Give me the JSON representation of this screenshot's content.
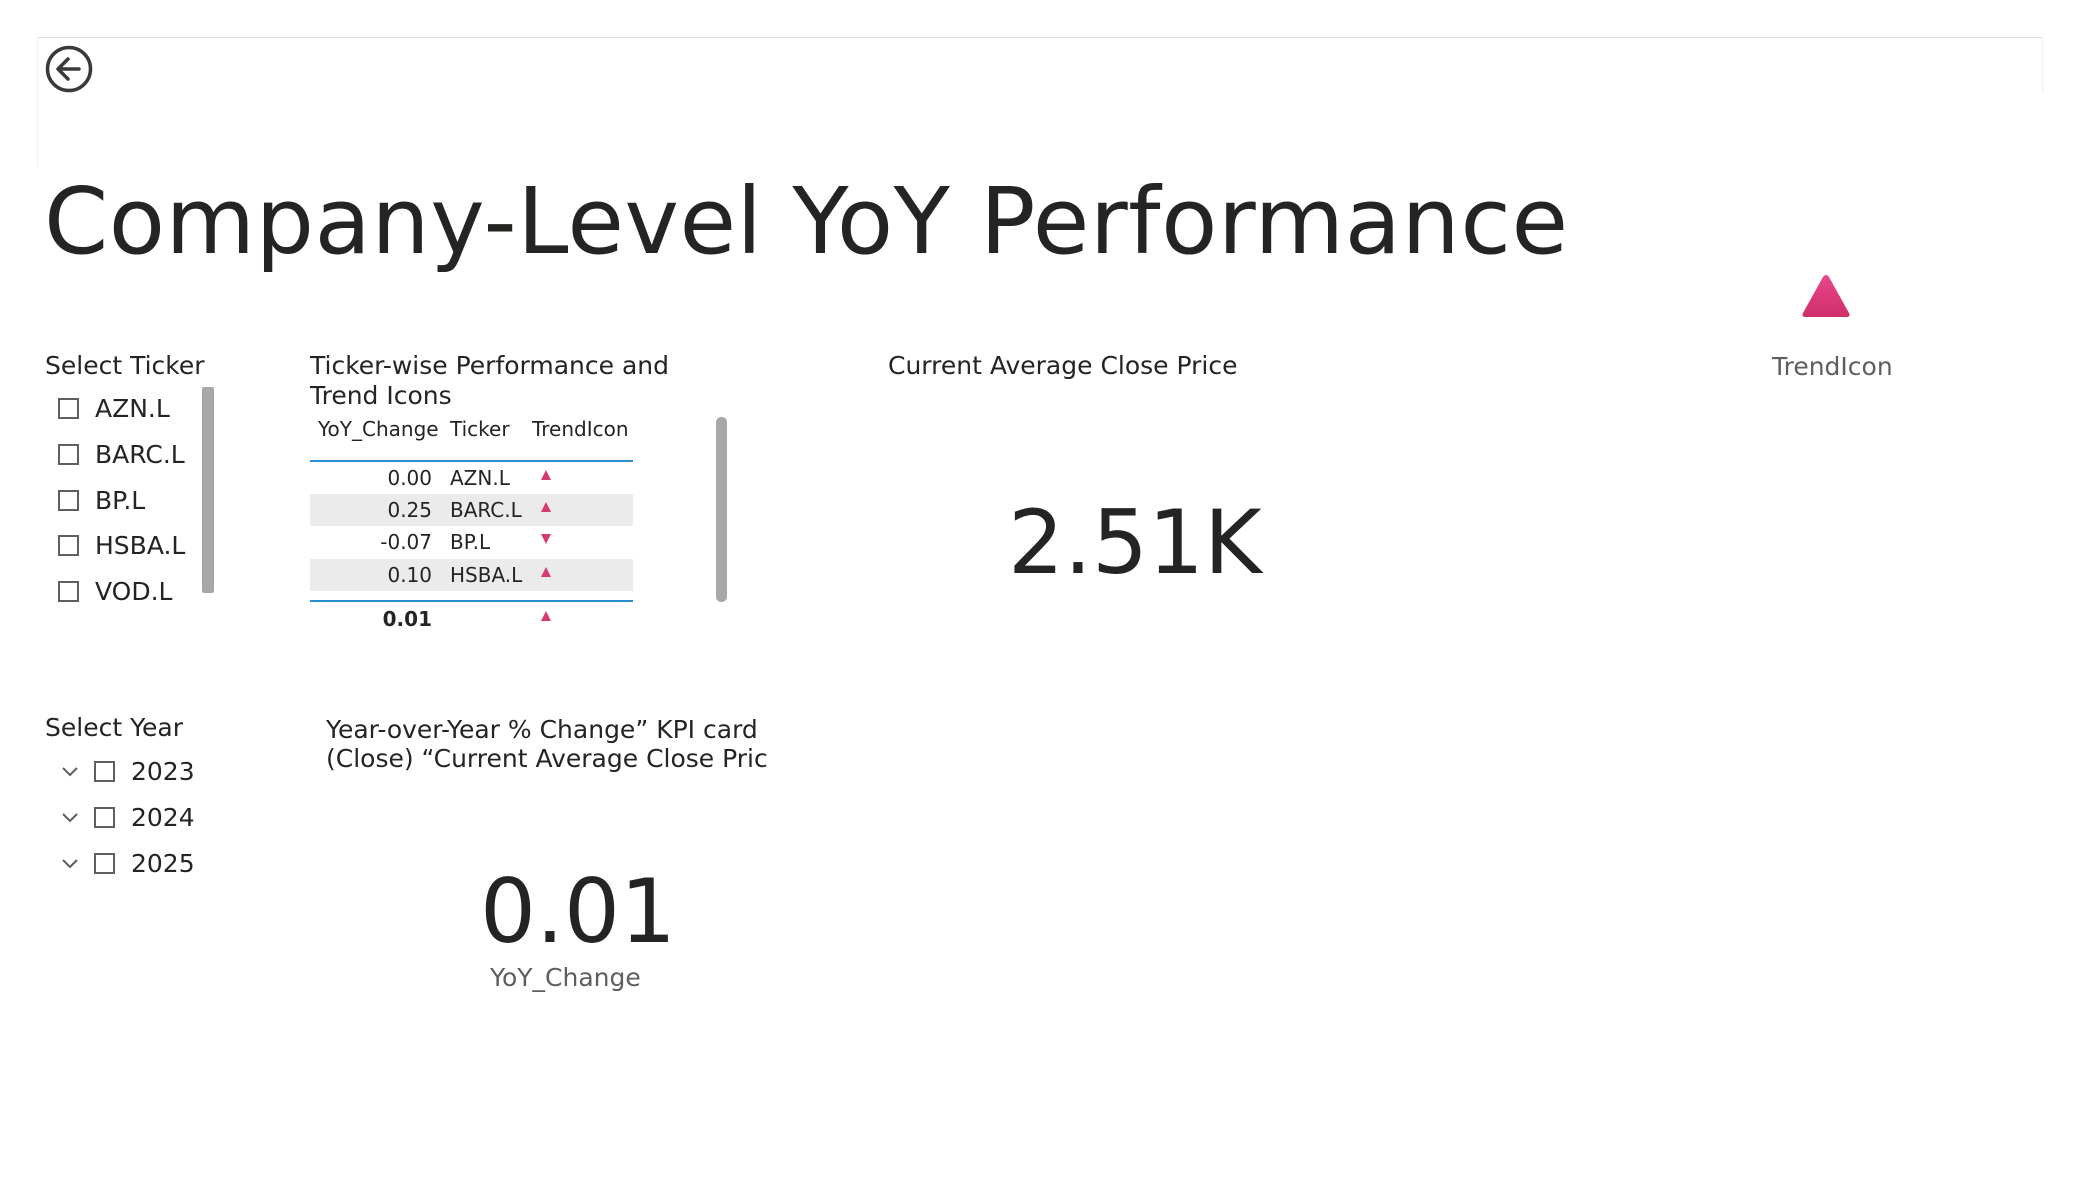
{
  "page": {
    "title": "Company-Level YoY Performance",
    "back_icon": "back-arrow-circle-icon"
  },
  "ticker_slicer": {
    "title": "Select Ticker",
    "items": [
      {
        "label": "AZN.L",
        "checked": false
      },
      {
        "label": "BARC.L",
        "checked": false
      },
      {
        "label": "BP.L",
        "checked": false
      },
      {
        "label": "HSBA.L",
        "checked": false
      },
      {
        "label": "VOD.L",
        "checked": false
      }
    ]
  },
  "year_slicer": {
    "title": "Select Year",
    "items": [
      {
        "label": "2023",
        "checked": false,
        "expand_icon": "chevron-down-icon"
      },
      {
        "label": "2024",
        "checked": false,
        "expand_icon": "chevron-down-icon"
      },
      {
        "label": "2025",
        "checked": false,
        "expand_icon": "chevron-down-icon"
      }
    ]
  },
  "trend_table": {
    "title_line1": "Ticker-wise Performance and",
    "title_line2": "Trend Icons",
    "columns": [
      "YoY_Change",
      "Ticker",
      "TrendIcon"
    ],
    "rows": [
      {
        "yoy": "0.00",
        "ticker": "AZN.L",
        "trend": "up"
      },
      {
        "yoy": "0.25",
        "ticker": "BARC.L",
        "trend": "up"
      },
      {
        "yoy": "-0.07",
        "ticker": "BP.L",
        "trend": "down"
      },
      {
        "yoy": "0.10",
        "ticker": "HSBA.L",
        "trend": "up"
      }
    ],
    "total": {
      "yoy": "0.01",
      "trend": "up"
    }
  },
  "avg_close_card": {
    "title": "Current Average Close Price",
    "value": "2.51K"
  },
  "trend_icon_card": {
    "label": "TrendIcon",
    "trend": "up"
  },
  "yoy_card": {
    "title_line1": "Year-over-Year % Change” KPI card",
    "title_line2": "(Close) “Current Average Close Pric",
    "value": "0.01",
    "label": "YoY_Change"
  },
  "colors": {
    "trend_pink": "#d63a73",
    "table_accent": "#2a8fd0",
    "row_alt": "#ebebeb",
    "text": "#252423"
  }
}
